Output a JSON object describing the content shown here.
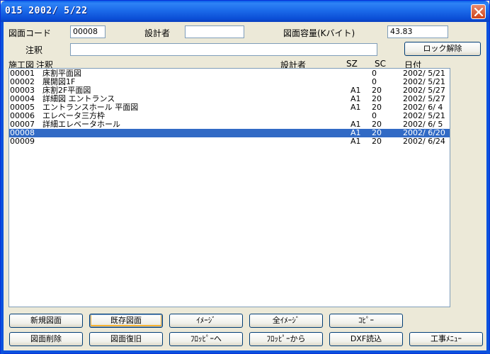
{
  "window": {
    "title": "015  2002/ 5/22"
  },
  "form": {
    "drawing_code_label": "図面コード",
    "drawing_code_value": "00008",
    "designer_label": "設計者",
    "designer_value": "",
    "capacity_label": "図面容量(Kバイト)",
    "capacity_value": "43.83",
    "note_label": "注釈",
    "note_value": "",
    "unlock_button": "ロック解除"
  },
  "columns": {
    "code": "施工図",
    "note": "注釈",
    "designer": "設計者",
    "sz": "SZ",
    "sc": "SC",
    "date": "日付"
  },
  "rows": [
    {
      "code": "00001",
      "note": "床割平面図",
      "sz": "",
      "sc": "0",
      "date": "2002/ 5/21"
    },
    {
      "code": "00002",
      "note": "展開図1F",
      "sz": "",
      "sc": "0",
      "date": "2002/ 5/21"
    },
    {
      "code": "00003",
      "note": "床割2F平面図",
      "sz": "A1",
      "sc": "20",
      "date": "2002/ 5/27"
    },
    {
      "code": "00004",
      "note": "詳細図 エントランス",
      "sz": "A1",
      "sc": "20",
      "date": "2002/ 5/27"
    },
    {
      "code": "00005",
      "note": "エントランスホール  平面図",
      "sz": "A1",
      "sc": "20",
      "date": "2002/ 6/ 4"
    },
    {
      "code": "00006",
      "note": "エレベータ三方枠",
      "sz": "",
      "sc": "0",
      "date": "2002/ 5/21"
    },
    {
      "code": "00007",
      "note": "詳細エレベータホール",
      "sz": "A1",
      "sc": "20",
      "date": "2002/ 6/ 5"
    },
    {
      "code": "00008",
      "note": "",
      "sz": "A1",
      "sc": "20",
      "date": "2002/ 6/20"
    },
    {
      "code": "00009",
      "note": "",
      "sz": "A1",
      "sc": "20",
      "date": "2002/ 6/24"
    }
  ],
  "selected_row": "00008",
  "buttons": {
    "new_drawing": "新規図面",
    "existing_drawing": "既存図面",
    "image": "ｲﾒｰｼﾞ",
    "all_images": "全ｲﾒｰｼﾞ",
    "copy": "ｺﾋﾟｰ",
    "delete_drawing": "図面削除",
    "restore_drawing": "図面復旧",
    "to_floppy": "ﾌﾛｯﾋﾟｰへ",
    "from_floppy": "ﾌﾛｯﾋﾟｰから",
    "dxf_read": "DXF読込",
    "construction_menu": "工事ﾒﾆｭｰ"
  },
  "colors": {
    "titlebar": "#0A5FE8",
    "selection": "#316AC5",
    "face": "#ECE9D8"
  },
  "icons": {
    "close": "close-icon"
  }
}
